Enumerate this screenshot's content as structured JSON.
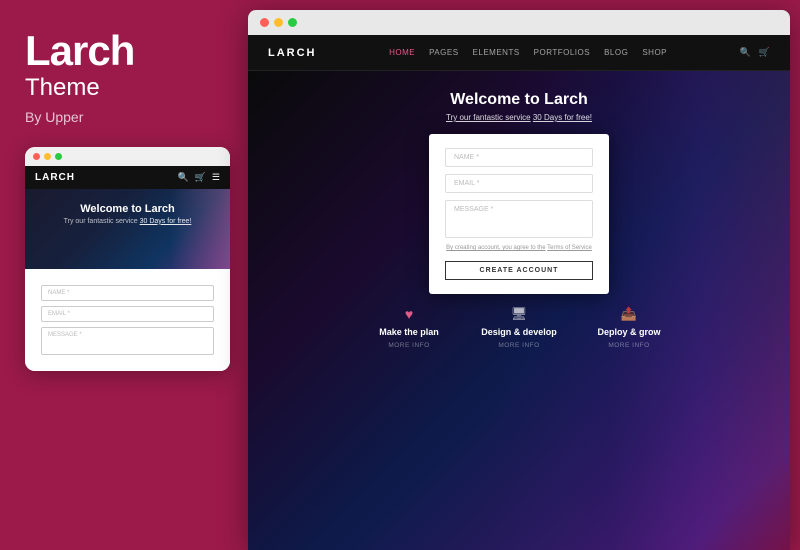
{
  "brand": {
    "title": "Larch",
    "subtitle": "Theme",
    "by": "By Upper"
  },
  "mobile": {
    "logo": "LARCH",
    "hero_title": "Welcome to Larch",
    "hero_sub": "Try our fantastic service",
    "hero_link": "30 Days for free!",
    "form": {
      "name_placeholder": "NAME *",
      "email_placeholder": "EMAIL *",
      "message_placeholder": "MESSAGE *"
    }
  },
  "desktop": {
    "logo": "LARCH",
    "nav_links": [
      "HOME",
      "PAGES",
      "ELEMENTS",
      "PORTFOLIOS",
      "BLOG",
      "SHOP"
    ],
    "active_link": "HOME",
    "hero_title": "Welcome to Larch",
    "hero_sub_plain": "Try our fantastic service",
    "hero_sub_link": "30 Days for free!",
    "form": {
      "name_placeholder": "NAME *",
      "email_placeholder": "EMAIL *",
      "message_placeholder": "MESSAGE *",
      "terms_text": "By creating account, you agree to the",
      "terms_link": "Terms of Service",
      "button_label": "CREATE ACCOUNT"
    },
    "features": [
      {
        "icon": "♥",
        "icon_class": "heart",
        "title": "Make the plan",
        "more": "MORE INFO"
      },
      {
        "icon": "▭",
        "icon_class": "monitor",
        "title": "Design & develop",
        "more": "MORE INFO"
      },
      {
        "icon": "↑",
        "icon_class": "deploy",
        "title": "Deploy & grow",
        "more": "MORE INFO"
      }
    ]
  },
  "browser": {
    "dots": [
      "red",
      "yellow",
      "green"
    ]
  }
}
